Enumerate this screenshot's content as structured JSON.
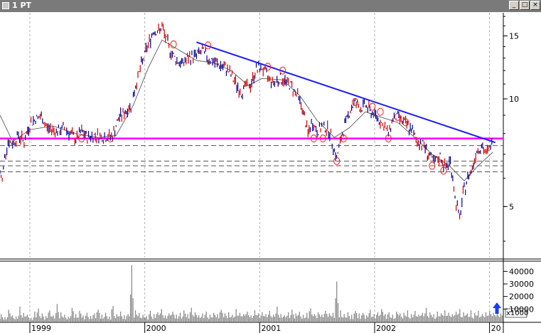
{
  "window": {
    "title": "1 PT"
  },
  "window_controls": {
    "minimize": "_",
    "maximize": "□",
    "close": "×"
  },
  "chart_data": [
    {
      "type": "line",
      "title": "",
      "xlabel": "",
      "ylabel": "",
      "x_ticks": [
        "1999",
        "2000",
        "2001",
        "2002",
        "20"
      ],
      "y_ticks": [
        5,
        10,
        15
      ],
      "ylim": [
        3.6,
        17.4
      ],
      "xlim": [
        1998.74,
        2003.12
      ],
      "grid": true,
      "price_series": [
        {
          "x": 1998.74,
          "y": 6.2
        },
        {
          "x": 1998.76,
          "y": 5.9
        },
        {
          "x": 1998.78,
          "y": 6.9
        },
        {
          "x": 1998.81,
          "y": 7.6
        },
        {
          "x": 1998.85,
          "y": 7.5
        },
        {
          "x": 1998.9,
          "y": 7.9
        },
        {
          "x": 1998.95,
          "y": 7.6
        },
        {
          "x": 1999.0,
          "y": 8.5
        },
        {
          "x": 1999.05,
          "y": 8.8
        },
        {
          "x": 1999.1,
          "y": 8.9
        },
        {
          "x": 1999.15,
          "y": 8.3
        },
        {
          "x": 1999.2,
          "y": 8.2
        },
        {
          "x": 1999.25,
          "y": 8.1
        },
        {
          "x": 1999.3,
          "y": 8.3
        },
        {
          "x": 1999.35,
          "y": 8.0
        },
        {
          "x": 1999.4,
          "y": 7.7
        },
        {
          "x": 1999.45,
          "y": 8.1
        },
        {
          "x": 1999.5,
          "y": 7.8
        },
        {
          "x": 1999.55,
          "y": 7.9
        },
        {
          "x": 1999.6,
          "y": 7.9
        },
        {
          "x": 1999.65,
          "y": 7.8
        },
        {
          "x": 1999.72,
          "y": 7.9
        },
        {
          "x": 1999.78,
          "y": 8.9
        },
        {
          "x": 1999.83,
          "y": 9.2
        },
        {
          "x": 1999.88,
          "y": 9.6
        },
        {
          "x": 1999.93,
          "y": 11.2
        },
        {
          "x": 1999.98,
          "y": 12.7
        },
        {
          "x": 2000.03,
          "y": 14.2
        },
        {
          "x": 2000.08,
          "y": 15.6
        },
        {
          "x": 2000.12,
          "y": 15.4
        },
        {
          "x": 2000.15,
          "y": 15.9
        },
        {
          "x": 2000.18,
          "y": 14.8
        },
        {
          "x": 2000.22,
          "y": 13.7
        },
        {
          "x": 2000.27,
          "y": 12.9
        },
        {
          "x": 2000.32,
          "y": 12.5
        },
        {
          "x": 2000.38,
          "y": 13.0
        },
        {
          "x": 2000.44,
          "y": 13.2
        },
        {
          "x": 2000.5,
          "y": 13.6
        },
        {
          "x": 2000.55,
          "y": 13.0
        },
        {
          "x": 2000.6,
          "y": 12.7
        },
        {
          "x": 2000.65,
          "y": 12.4
        },
        {
          "x": 2000.72,
          "y": 12.1
        },
        {
          "x": 2000.78,
          "y": 11.2
        },
        {
          "x": 2000.84,
          "y": 10.4
        },
        {
          "x": 2000.88,
          "y": 10.9
        },
        {
          "x": 2000.92,
          "y": 10.9
        },
        {
          "x": 2000.97,
          "y": 12.1
        },
        {
          "x": 2001.02,
          "y": 12.2
        },
        {
          "x": 2001.07,
          "y": 11.5
        },
        {
          "x": 2001.12,
          "y": 11.1
        },
        {
          "x": 2001.18,
          "y": 11.4
        },
        {
          "x": 2001.22,
          "y": 11.2
        },
        {
          "x": 2001.27,
          "y": 10.9
        },
        {
          "x": 2001.33,
          "y": 10.2
        },
        {
          "x": 2001.37,
          "y": 9.4
        },
        {
          "x": 2001.42,
          "y": 8.0
        },
        {
          "x": 2001.46,
          "y": 8.6
        },
        {
          "x": 2001.5,
          "y": 8.1
        },
        {
          "x": 2001.55,
          "y": 8.4
        },
        {
          "x": 2001.6,
          "y": 8.2
        },
        {
          "x": 2001.64,
          "y": 7.4
        },
        {
          "x": 2001.67,
          "y": 6.8
        },
        {
          "x": 2001.72,
          "y": 8.0
        },
        {
          "x": 2001.78,
          "y": 9.2
        },
        {
          "x": 2001.83,
          "y": 9.8
        },
        {
          "x": 2001.88,
          "y": 9.4
        },
        {
          "x": 2001.92,
          "y": 9.6
        },
        {
          "x": 2001.97,
          "y": 9.2
        },
        {
          "x": 2002.02,
          "y": 8.9
        },
        {
          "x": 2002.07,
          "y": 8.5
        },
        {
          "x": 2002.12,
          "y": 8.0
        },
        {
          "x": 2002.17,
          "y": 9.0
        },
        {
          "x": 2002.22,
          "y": 8.8
        },
        {
          "x": 2002.27,
          "y": 8.5
        },
        {
          "x": 2002.32,
          "y": 8.2
        },
        {
          "x": 2002.37,
          "y": 7.6
        },
        {
          "x": 2002.42,
          "y": 7.5
        },
        {
          "x": 2002.47,
          "y": 7.0
        },
        {
          "x": 2002.52,
          "y": 6.6
        },
        {
          "x": 2002.57,
          "y": 6.9
        },
        {
          "x": 2002.62,
          "y": 6.4
        },
        {
          "x": 2002.66,
          "y": 6.7
        },
        {
          "x": 2002.7,
          "y": 5.3
        },
        {
          "x": 2002.74,
          "y": 4.6
        },
        {
          "x": 2002.77,
          "y": 5.4
        },
        {
          "x": 2002.81,
          "y": 6.0
        },
        {
          "x": 2002.85,
          "y": 6.4
        },
        {
          "x": 2002.89,
          "y": 7.2
        },
        {
          "x": 2002.93,
          "y": 7.4
        },
        {
          "x": 2002.97,
          "y": 7.0
        },
        {
          "x": 2003.0,
          "y": 7.3
        },
        {
          "x": 2003.03,
          "y": 7.5
        }
      ],
      "moving_average": [
        {
          "x": 1998.74,
          "y": 9.0
        },
        {
          "x": 1998.85,
          "y": 7.6
        },
        {
          "x": 1999.0,
          "y": 8.2
        },
        {
          "x": 1999.2,
          "y": 8.4
        },
        {
          "x": 1999.4,
          "y": 8.0
        },
        {
          "x": 1999.6,
          "y": 7.8
        },
        {
          "x": 1999.75,
          "y": 7.9
        },
        {
          "x": 1999.9,
          "y": 9.6
        },
        {
          "x": 2000.03,
          "y": 12.2
        },
        {
          "x": 2000.15,
          "y": 14.6
        },
        {
          "x": 2000.28,
          "y": 13.8
        },
        {
          "x": 2000.45,
          "y": 12.8
        },
        {
          "x": 2000.6,
          "y": 12.6
        },
        {
          "x": 2000.75,
          "y": 12.0
        },
        {
          "x": 2000.9,
          "y": 10.9
        },
        {
          "x": 2001.02,
          "y": 11.4
        },
        {
          "x": 2001.2,
          "y": 11.3
        },
        {
          "x": 2001.35,
          "y": 10.2
        },
        {
          "x": 2001.5,
          "y": 8.7
        },
        {
          "x": 2001.65,
          "y": 7.8
        },
        {
          "x": 2001.78,
          "y": 8.3
        },
        {
          "x": 2001.92,
          "y": 9.2
        },
        {
          "x": 2002.05,
          "y": 8.9
        },
        {
          "x": 2002.2,
          "y": 8.6
        },
        {
          "x": 2002.35,
          "y": 7.8
        },
        {
          "x": 2002.5,
          "y": 7.0
        },
        {
          "x": 2002.65,
          "y": 6.5
        },
        {
          "x": 2002.78,
          "y": 5.9
        },
        {
          "x": 2002.9,
          "y": 6.5
        },
        {
          "x": 2003.03,
          "y": 7.1
        }
      ],
      "downtrend_line": [
        {
          "x": 2000.45,
          "y": 14.4
        },
        {
          "x": 2003.05,
          "y": 7.55
        }
      ],
      "support_line": {
        "y": 7.75
      },
      "dashed_levels": [
        7.4,
        6.7,
        6.5,
        6.25
      ],
      "marked_points": [
        {
          "x": 1999.45,
          "y": 7.75
        },
        {
          "x": 1999.7,
          "y": 7.75
        },
        {
          "x": 2000.25,
          "y": 14.2
        },
        {
          "x": 2000.55,
          "y": 14.1
        },
        {
          "x": 2001.07,
          "y": 12.3
        },
        {
          "x": 2001.2,
          "y": 12.0
        },
        {
          "x": 2001.47,
          "y": 7.75
        },
        {
          "x": 2001.55,
          "y": 7.75
        },
        {
          "x": 2001.67,
          "y": 6.7
        },
        {
          "x": 2001.73,
          "y": 7.75
        },
        {
          "x": 2001.83,
          "y": 9.8
        },
        {
          "x": 2001.98,
          "y": 9.5
        },
        {
          "x": 2002.05,
          "y": 9.2
        },
        {
          "x": 2002.12,
          "y": 7.75
        },
        {
          "x": 2002.2,
          "y": 8.9
        },
        {
          "x": 2002.27,
          "y": 8.6
        },
        {
          "x": 2002.5,
          "y": 6.5
        },
        {
          "x": 2002.6,
          "y": 6.3
        }
      ]
    },
    {
      "type": "bar",
      "title": "",
      "unit_label": "x1000",
      "y_ticks": [
        10000,
        20000,
        30000,
        40000
      ],
      "ylim": [
        0,
        47000
      ],
      "grid": true,
      "values": [
        6000,
        3500,
        9500,
        5000,
        4000,
        12000,
        7000,
        5500,
        3000,
        8000,
        10500,
        6500,
        4500,
        9000,
        5000,
        14000,
        7500,
        5500,
        4000,
        11000,
        6000,
        8500,
        5000,
        7000,
        4500,
        6500,
        9500,
        5500,
        7000,
        4000,
        12500,
        6000,
        8000,
        5000,
        6000,
        45000,
        9000,
        7000,
        5500,
        4500,
        8500,
        6000,
        7500,
        10000,
        5000,
        6500,
        8000,
        5500,
        7000,
        9000,
        6000,
        11000,
        7500,
        5000,
        6500,
        8000,
        5500,
        7000,
        6000,
        9500,
        6500,
        7500,
        5500,
        10000,
        7000,
        6000,
        8000,
        5000,
        9000,
        6500,
        7500,
        6000,
        8500,
        5500,
        12000,
        6000,
        5000,
        7500,
        9500,
        6500,
        8000,
        5500,
        7000,
        10500,
        6000,
        7500,
        5500,
        8500,
        6500,
        7000,
        32000,
        9000,
        6000,
        7500,
        5500,
        8500,
        6500,
        7000,
        5000,
        9500,
        6000,
        7500,
        10000,
        6000,
        7500,
        5500,
        8000,
        6500,
        7000,
        9000,
        6000,
        8500,
        5500,
        7000,
        11000,
        7500,
        6000,
        8000,
        6500,
        9000,
        7000,
        6000,
        8000,
        10000,
        7500,
        6500,
        9000,
        7000,
        8500,
        6000,
        7500,
        8500,
        7000,
        9500,
        6500
      ],
      "arrow": "blue up arrow"
    }
  ],
  "colors": {
    "titlebar": "#7a7a7a",
    "price_up": "#cc0000",
    "price_down": "#000090",
    "moving_average": "#6a6a6a",
    "downtrend_line": "#1a1aff",
    "support_line": "#ff00ff",
    "markers": "#ff2020",
    "volume": "#8c8c8c",
    "arrow": "#1a3cff"
  }
}
